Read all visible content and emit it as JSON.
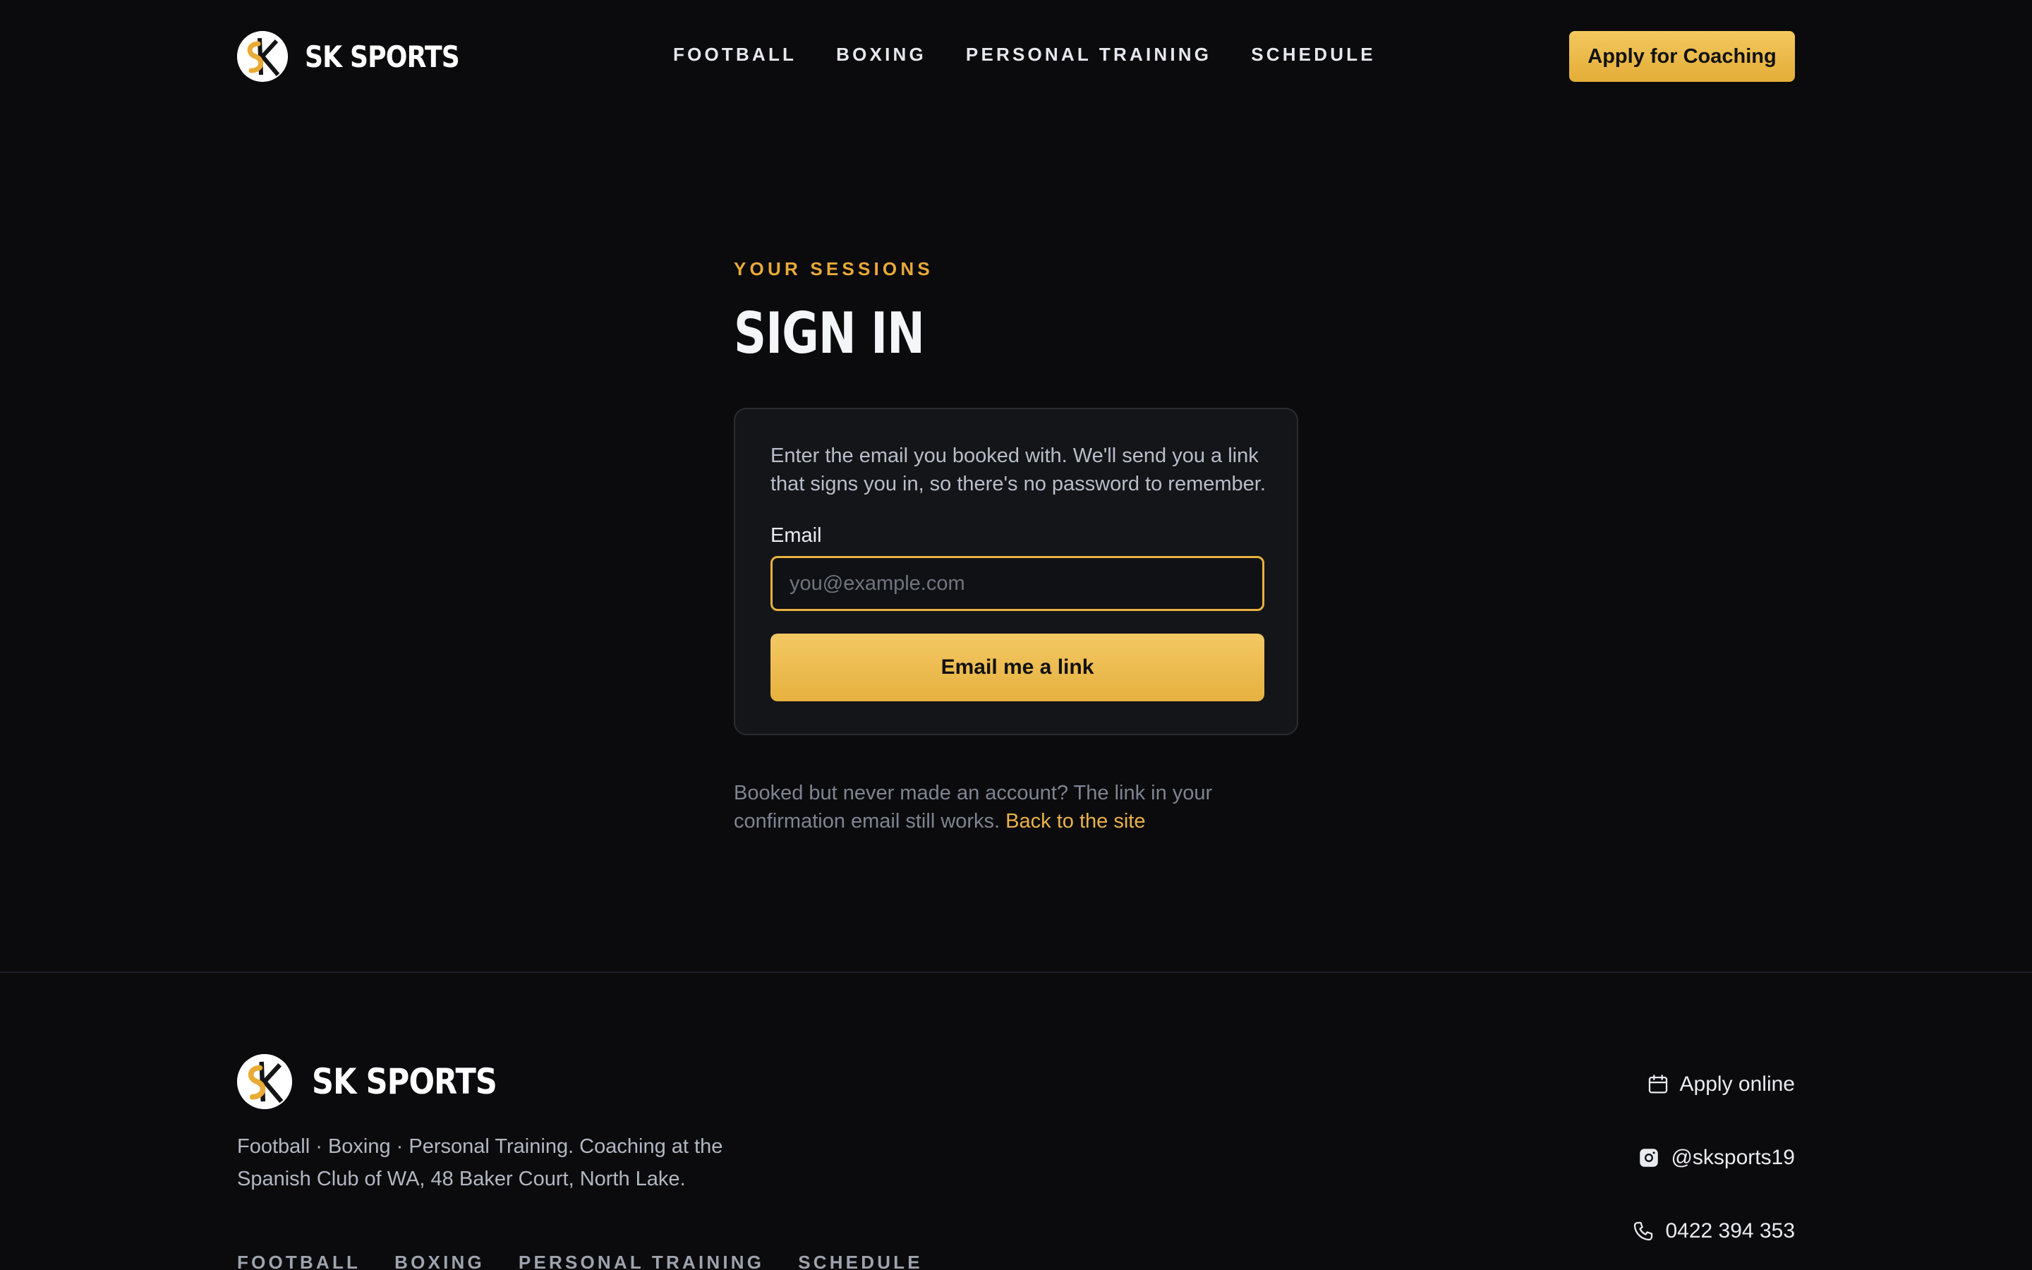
{
  "brand": {
    "name": "SK SPORTS"
  },
  "nav": [
    "FOOTBALL",
    "BOXING",
    "PERSONAL TRAINING",
    "SCHEDULE"
  ],
  "header": {
    "cta_label": "Apply for Coaching"
  },
  "signin": {
    "eyebrow": "YOUR SESSIONS",
    "title": "SIGN IN",
    "description": "Enter the email you booked with. We'll send you a link that signs you in, so there's no password to remember.",
    "email_label": "Email",
    "email_placeholder": "you@example.com",
    "email_value": "",
    "submit_label": "Email me a link",
    "footnote": "Booked but never made an account? The link in your confirmation email still works.",
    "back_link": "Back to the site"
  },
  "footer": {
    "brand_name": "SK SPORTS",
    "description": "Football · Boxing · Personal Training. Coaching at the Spanish Club of WA, 48 Baker Court, North Lake.",
    "nav": [
      "FOOTBALL",
      "BOXING",
      "PERSONAL TRAINING",
      "SCHEDULE"
    ],
    "contacts": [
      {
        "icon": "calendar-icon",
        "label": "Apply online"
      },
      {
        "icon": "instagram-icon",
        "label": "@sksports19"
      },
      {
        "icon": "phone-icon",
        "label": "0422 394 353"
      }
    ]
  },
  "colors": {
    "background": "#0b0b0d",
    "accent": "#e7b13f",
    "card": "#141518",
    "eyebrow": "#e9a93a"
  }
}
